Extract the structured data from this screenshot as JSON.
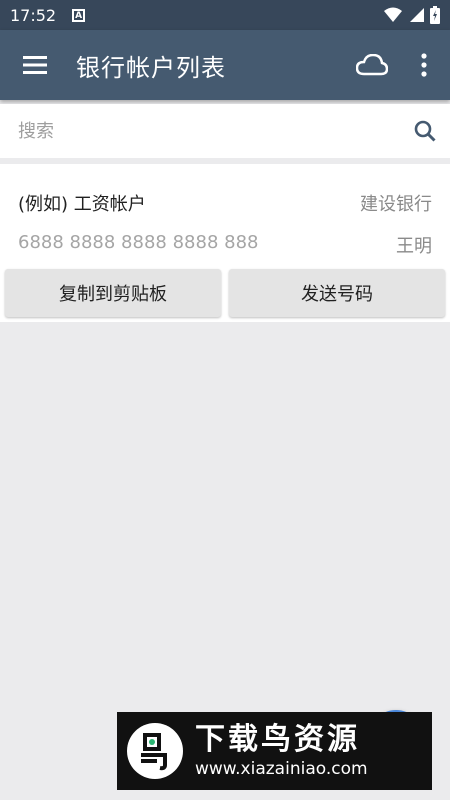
{
  "status_bar": {
    "time": "17:52",
    "notification_letter": "A"
  },
  "app_bar": {
    "title": "银行帐户列表",
    "icons": [
      "menu-icon",
      "cloud-icon",
      "more-vert-icon"
    ]
  },
  "search": {
    "placeholder": "搜索",
    "value": ""
  },
  "account": {
    "name": "(例如) 工资帐户",
    "bank": "建设银行",
    "number": "6888 8888 8888 8888 888",
    "holder": "王明",
    "copy_label": "复制到剪贴板",
    "send_label": "发送号码"
  },
  "watermark": {
    "logo_char": "鸟",
    "name": "下载鸟资源",
    "url": "www.xiazainiao.com"
  },
  "colors": {
    "status_bar": "#37475a",
    "app_bar": "#455a70",
    "background": "#ebebed",
    "fab": "#4a86d8"
  }
}
